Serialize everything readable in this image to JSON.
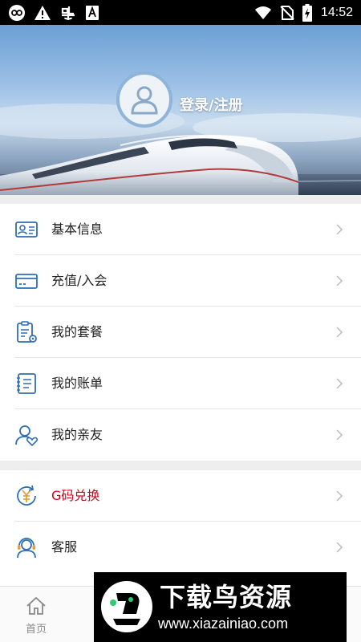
{
  "status_bar": {
    "time": "14:52",
    "left_icons": [
      "loop-icon",
      "warning-icon",
      "bug-icon",
      "font-icon"
    ],
    "right_icons": [
      "wifi-icon",
      "no-sim-icon",
      "battery-charging-icon"
    ]
  },
  "header": {
    "login_text": "登录/注册"
  },
  "menu_groups": [
    {
      "items": [
        {
          "id": "basic-info",
          "icon": "id-card-icon",
          "label": "基本信息",
          "color": "#222222"
        },
        {
          "id": "recharge",
          "icon": "card-icon",
          "label": "充值/入会",
          "color": "#222222"
        },
        {
          "id": "my-package",
          "icon": "clipboard-gear-icon",
          "label": "我的套餐",
          "color": "#222222"
        },
        {
          "id": "my-bill",
          "icon": "notebook-icon",
          "label": "我的账单",
          "color": "#222222"
        },
        {
          "id": "my-family",
          "icon": "person-heart-icon",
          "label": "我的亲友",
          "color": "#222222"
        }
      ]
    },
    {
      "items": [
        {
          "id": "g-code-redeem",
          "icon": "yen-refresh-icon",
          "label": "G码兑换",
          "color": "#d0021b"
        },
        {
          "id": "customer-service",
          "icon": "headset-icon",
          "label": "客服",
          "color": "#222222"
        }
      ]
    }
  ],
  "bottom_nav": {
    "home_label": "首页"
  },
  "watermark": {
    "title": "下载鸟资源",
    "url": "www.xiazainiao.com"
  },
  "colors": {
    "accent_blue": "#2f6fb5",
    "highlight_red": "#d0021b",
    "icon_gold": "#e0a43a"
  }
}
